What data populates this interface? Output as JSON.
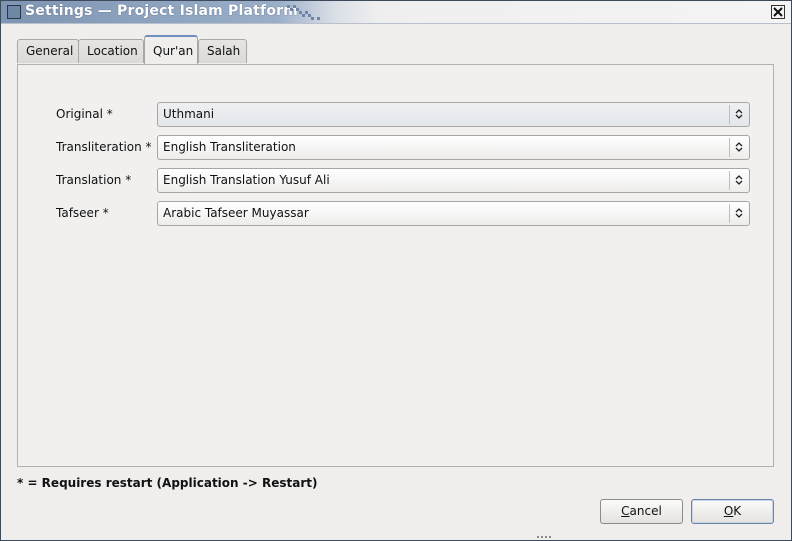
{
  "window": {
    "title": "Settings — Project Islam Platform"
  },
  "tabs": [
    {
      "label": "General"
    },
    {
      "label": "Location"
    },
    {
      "label": "Qur'an"
    },
    {
      "label": "Salah"
    }
  ],
  "active_tab": "Qur'an",
  "quran": {
    "original": {
      "label": "Original *",
      "value": "Uthmani"
    },
    "transliteration": {
      "label": "Transliteration *",
      "value": "English Transliteration"
    },
    "translation": {
      "label": "Translation *",
      "value": "English Translation Yusuf Ali"
    },
    "tafseer": {
      "label": "Tafseer *",
      "value": "Arabic Tafseer Muyassar"
    }
  },
  "footer": {
    "note": "* = Requires restart (Application -> Restart)",
    "cancel_first": "C",
    "cancel_rest": "ancel",
    "ok_first": "O",
    "ok_rest": "K"
  },
  "colors": {
    "titlebar_accent": "#7e95b3",
    "tab_focus": "#6e8fbf"
  },
  "icons": {
    "window_icon": "window-icon",
    "close": "close-icon",
    "combo_arrow": "updown-arrows-icon"
  }
}
